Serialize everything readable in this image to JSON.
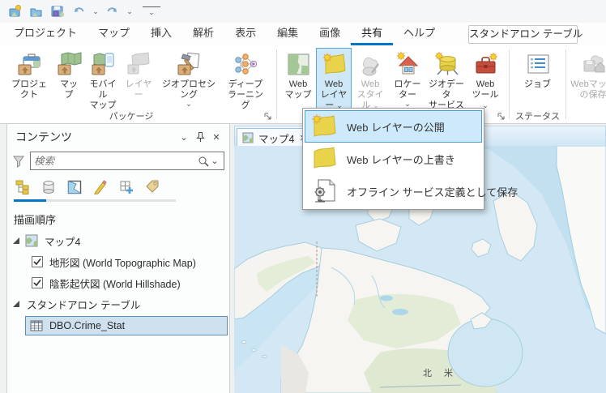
{
  "icons": {
    "chevron_down": "⌄",
    "close": "✕",
    "overflow_chevron": "⌄"
  },
  "tabs": {
    "items": [
      "プロジェクト",
      "マップ",
      "挿入",
      "解析",
      "表示",
      "編集",
      "画像",
      "共有",
      "ヘルプ"
    ],
    "active": "共有",
    "contextual": "スタンドアロン テーブル"
  },
  "ribbon": {
    "groups": [
      {
        "label": "パッケージ",
        "items": [
          {
            "lines": [
              "プロジェクト"
            ]
          },
          {
            "lines": [
              "マップ"
            ]
          },
          {
            "lines": [
              "モバイル",
              "マップ"
            ]
          },
          {
            "lines": [
              "レイヤー"
            ],
            "disabled": true
          },
          {
            "lines": [
              "ジオプロセシング"
            ],
            "dropdown": true
          },
          {
            "lines": [
              "ディープ",
              "ラーニング"
            ]
          }
        ]
      },
      {
        "label": "",
        "items": [
          {
            "lines": [
              "Web",
              "マップ"
            ]
          },
          {
            "lines": [
              "Web",
              "レイヤー"
            ],
            "dropdown": true,
            "active": true
          },
          {
            "lines": [
              "Web",
              "スタイル"
            ],
            "dropdown": true,
            "disabled": true
          },
          {
            "lines": [
              "ロケーター"
            ],
            "dropdown": true
          },
          {
            "lines": [
              "ジオデータ",
              "サービス"
            ],
            "dropdown": true
          },
          {
            "lines": [
              "Web",
              "ツール"
            ],
            "dropdown": true
          }
        ]
      },
      {
        "label": "ステータス",
        "items": [
          {
            "lines": [
              "ジョブ"
            ]
          }
        ]
      },
      {
        "label": "",
        "items": [
          {
            "lines": [
              "Webマップ",
              "の保存"
            ],
            "disabled": true
          }
        ]
      }
    ]
  },
  "share_menu": {
    "items": [
      "Web レイヤーの公開",
      "Web レイヤーの上書き",
      "オフライン サービス定義として保存"
    ],
    "selected": "Web レイヤーの公開"
  },
  "contents": {
    "title": "コンテンツ",
    "search_placeholder": "検索",
    "section_heading": "描画順序",
    "map_item": "マップ4",
    "layer_items": [
      "地形図 (World Topographic Map)",
      "陰影起伏図 (World Hillshade)"
    ],
    "standalone_header": "スタンドアロン テーブル",
    "table_item": "DBO.Crime_Stat"
  },
  "map_view": {
    "tab": "マップ4",
    "region_label": "北 米"
  },
  "colors": {
    "accent": "#0077c8",
    "ribbon_active_bg": "#cfe8f8",
    "menu_selected_bg": "#cde9fb",
    "tree_selected_bg": "#cfe0ef",
    "ocean": "#d3e8f4",
    "land": "#f6f5f1",
    "vegetation": "#e2ecd6"
  }
}
